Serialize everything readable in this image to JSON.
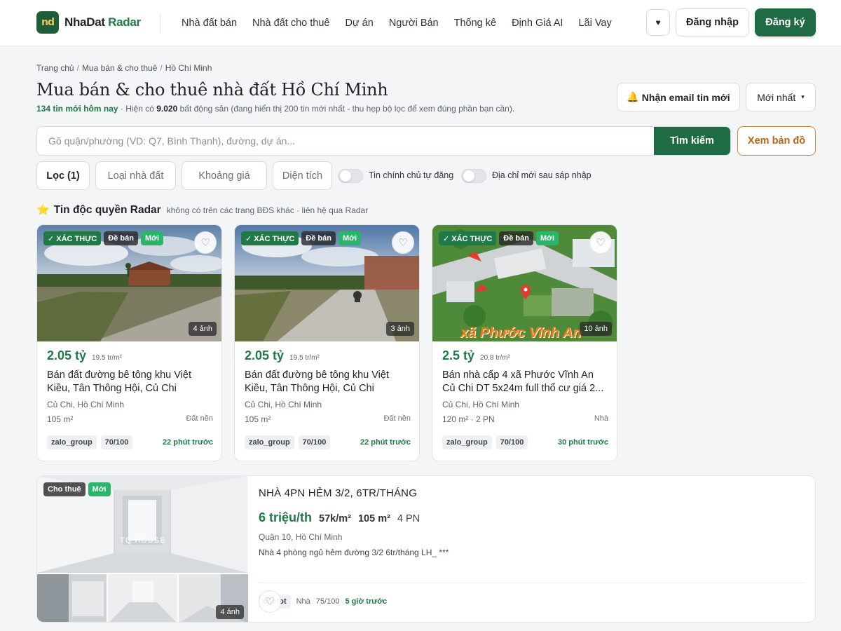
{
  "header": {
    "logo_text_1": "NhaDat",
    "logo_text_2": "Radar",
    "logo_mark": "nd",
    "nav": [
      "Nhà đất bán",
      "Nhà đất cho thuê",
      "Dự án",
      "Người Bán",
      "Thống kê",
      "Định Giá AI",
      "Lãi Vay"
    ],
    "favorites_icon": "♥",
    "login_label": "Đăng nhập",
    "signup_label": "Đăng ký"
  },
  "breadcrumb": [
    "Trang chủ",
    "Mua bán & cho thuê",
    "Hồ Chí Minh"
  ],
  "page": {
    "title": "Mua bán & cho thuê nhà đất Hồ Chí Minh",
    "new_today": "134 tin mới hôm nay",
    "summary_prefix": " · Hiện có ",
    "total_count": "9.020",
    "summary_suffix": " bất động sản (đang hiển thị 200 tin mới nhất - thu hẹp bộ lọc để xem đúng phần bạn cần).",
    "email_label": "Nhận email tin mới",
    "email_icon": "🔔",
    "sort_label": "Mới nhất",
    "sort_caret": "▾"
  },
  "search": {
    "placeholder": "Gõ quận/phường (VD: Q7, Bình Thạnh), đường, dự án...",
    "button": "Tìm kiếm",
    "map_button": "Xem bản đồ"
  },
  "filters": {
    "filter_label": "Lọc (1)",
    "type": "Loại nhà đất",
    "price": "Khoảng giá",
    "area": "Diện tích",
    "toggle_owner": "Tin chính chủ tự đăng",
    "toggle_address": "Địa chỉ mới sau sáp nhập"
  },
  "exclusive": {
    "star": "⭐",
    "title": "Tin độc quyền Radar",
    "subtitle": "không có trên các trang BĐS khác · liên hệ qua Radar"
  },
  "cards": [
    {
      "badge_verify": "✓ XÁC THỰC",
      "badge_type": "Đề bán",
      "badge_new": "Mới",
      "photos": "4 ảnh",
      "price": "2.05 tỷ",
      "ppm": "19.5 tr/m²",
      "title": "Bán đất đường bê tông khu Việt Kiều, Tân Thông Hội, Củ Chi",
      "location": "Củ Chi, Hồ Chí Minh",
      "area": "105 m²",
      "type": "Đất nền",
      "source": "zalo_group",
      "score": "70/100",
      "ago": "22 phút trước"
    },
    {
      "badge_verify": "✓ XÁC THỰC",
      "badge_type": "Đề bán",
      "badge_new": "Mới",
      "photos": "3 ảnh",
      "price": "2.05 tỷ",
      "ppm": "19.5 tr/m²",
      "title": "Bán đất đường bê tông khu Việt Kiều, Tân Thông Hội, Củ Chi",
      "location": "Củ Chi, Hồ Chí Minh",
      "area": "105 m²",
      "type": "Đất nền",
      "source": "zalo_group",
      "score": "70/100",
      "ago": "22 phút trước"
    },
    {
      "badge_verify": "✓ XÁC THỰC",
      "badge_type": "Đề bán",
      "badge_new": "Mới",
      "photos": "10 ảnh",
      "price": "2.5 tỷ",
      "ppm": "20.8 tr/m²",
      "title": "Bán nhà cấp 4 xã Phước Vĩnh An Củ Chi DT 5x24m full thổ cư giá 2...",
      "location": "Củ Chi, Hồ Chí Minh",
      "area": "120 m² · 2 PN",
      "type": "Nhà",
      "source": "zalo_group",
      "score": "70/100",
      "ago": "30 phút trước",
      "map_overlay": "xã Phước Vĩnh An"
    }
  ],
  "rental": {
    "badge_type": "Cho thuê",
    "badge_new": "Mới",
    "photos": "4 ảnh",
    "watermark": "TQ HOUSE",
    "title": "NHÀ 4PN HẺM 3/2, 6TR/THÁNG",
    "price": "6 triệu/th",
    "ppm": "57k/m²",
    "area": "105 m²",
    "rooms": "4 PN",
    "location": "Quận 10, Hồ Chí Minh",
    "description": "Nhà 4 phòng ngủ hẻm đường 3/2 6tr/tháng LH_ ***",
    "source": "chotot",
    "type": "Nhà",
    "score": "75/100",
    "ago": "5 giờ trước"
  },
  "colors": {
    "brand_green": "#1f6b43",
    "price_green": "#1f7a47",
    "map_orange": "#b5661a"
  }
}
